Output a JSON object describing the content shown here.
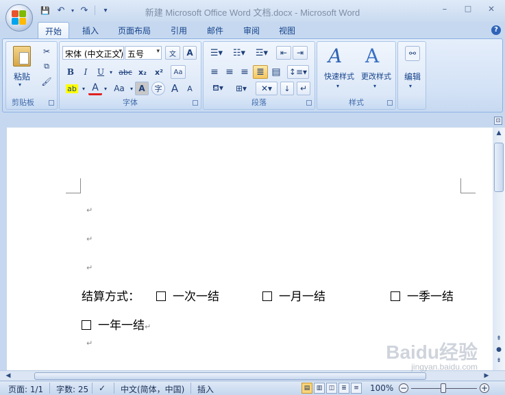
{
  "window": {
    "title": "新建 Microsoft Office Word 文档.docx - Microsoft Word",
    "minimize": "–",
    "maximize": "□",
    "close": "✕"
  },
  "quick_access": {
    "save": "💾",
    "undo": "↶",
    "redo": "↷",
    "customize": "▾"
  },
  "tabs": [
    "开始",
    "插入",
    "页面布局",
    "引用",
    "邮件",
    "审阅",
    "视图"
  ],
  "help": "?",
  "ribbon": {
    "clipboard": {
      "label": "剪贴板",
      "paste": "粘贴"
    },
    "font": {
      "label": "字体",
      "font_name": "宋体 (中文正文)",
      "font_size": "五号",
      "bold": "B",
      "italic": "I",
      "underline": "U",
      "strike": "abc",
      "subscript": "x₂",
      "superscript": "x²",
      "font_color_glyph": "A",
      "change_case": "Aa",
      "grow": "A",
      "shrink": "A"
    },
    "paragraph": {
      "label": "段落"
    },
    "styles": {
      "label": "样式",
      "quick_styles": "快速样式",
      "change_styles": "更改样式"
    },
    "editing": {
      "label": "编辑"
    }
  },
  "document": {
    "line1_label": "结算方式：",
    "options": [
      "一次一结",
      "一月一结",
      "一季一结",
      "一年一结"
    ],
    "para_mark": "↵"
  },
  "status": {
    "page": "页面: 1/1",
    "words": "字数: 25",
    "language": "中文(简体，中国)",
    "mode": "插入",
    "zoom": "100%"
  },
  "watermark": {
    "main": "Baidu经验",
    "sub": "jingyan.baidu.com"
  },
  "colors": {
    "ribbon_bg": "#d3e2f6",
    "accent": "#15428b",
    "highlight": "#f9d47a"
  }
}
